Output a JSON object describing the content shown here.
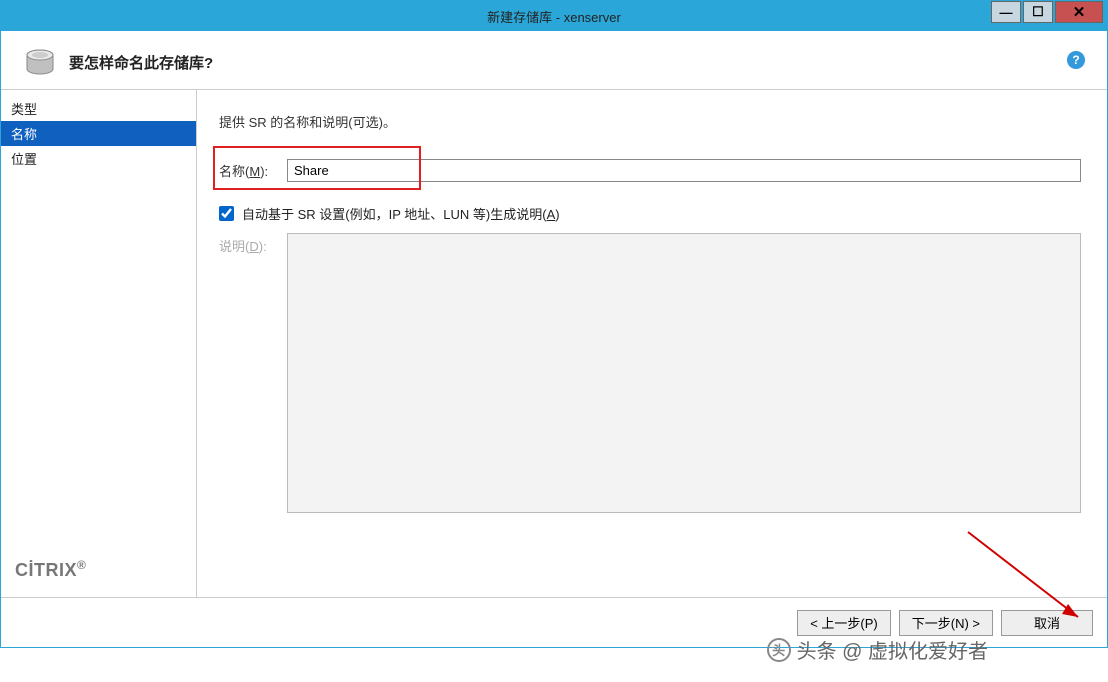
{
  "window": {
    "title": "新建存储库 - xenserver"
  },
  "header": {
    "title": "要怎样命名此存储库?"
  },
  "sidebar": {
    "items": [
      {
        "label": "类型",
        "selected": false
      },
      {
        "label": "名称",
        "selected": true
      },
      {
        "label": "位置",
        "selected": false
      }
    ],
    "brand": "CITRIX"
  },
  "content": {
    "instruction": "提供 SR 的名称和说明(可选)。",
    "name_label": "名称(M):",
    "name_value": "Share",
    "auto_checkbox_label": "自动基于 SR 设置(例如，IP 地址、LUN 等)生成说明(A)",
    "auto_checked": true,
    "desc_label": "说明(D):",
    "desc_value": ""
  },
  "footer": {
    "back": "< 上一步(P)",
    "next": "下一步(N) >",
    "cancel": "取消"
  },
  "watermark": "头条 @ 虚拟化爱好者"
}
